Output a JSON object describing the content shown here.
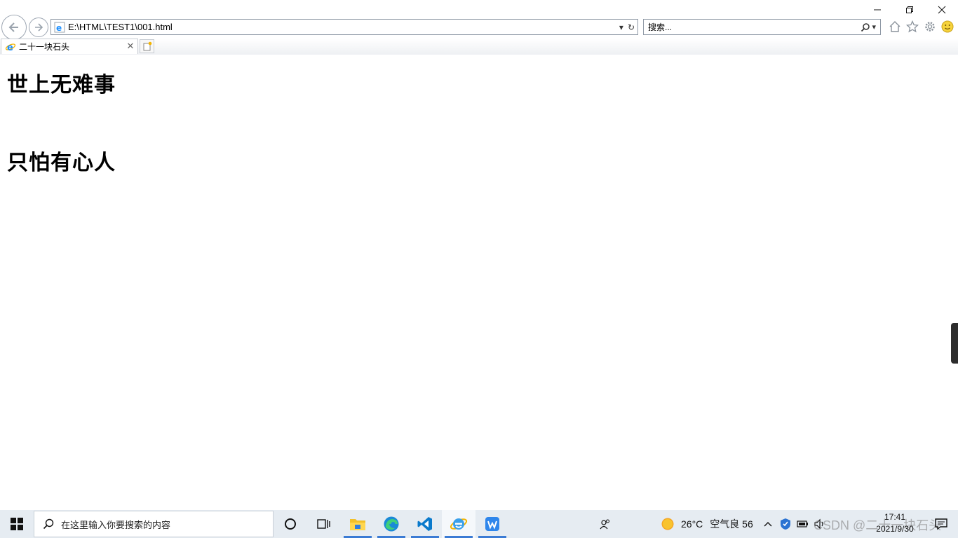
{
  "browser": {
    "address": "E:\\HTML\\TEST1\\001.html",
    "search_placeholder": "搜索...",
    "tab_title": "二十一块石头",
    "window_controls": [
      "minimize-icon",
      "restore-icon",
      "close-icon"
    ],
    "toolbar_icons": [
      "home-icon",
      "favorites-star-icon",
      "gear-icon",
      "smiley-icon"
    ],
    "brand_color": "#1e90ff"
  },
  "page": {
    "heading_1": "世上无难事",
    "heading_2": "只怕有心人"
  },
  "taskbar": {
    "search_placeholder": "在这里输入你要搜索的内容",
    "apps": [
      "cortana-icon",
      "task-view-icon",
      "file-explorer-icon",
      "edge-icon",
      "vscode-icon",
      "ie-icon",
      "wps-icon"
    ],
    "weather": "26°C",
    "air_quality": "空气良 56",
    "time": "17:41",
    "date": "2021/9/30",
    "watermark": "CSDN @二十一块石头"
  }
}
